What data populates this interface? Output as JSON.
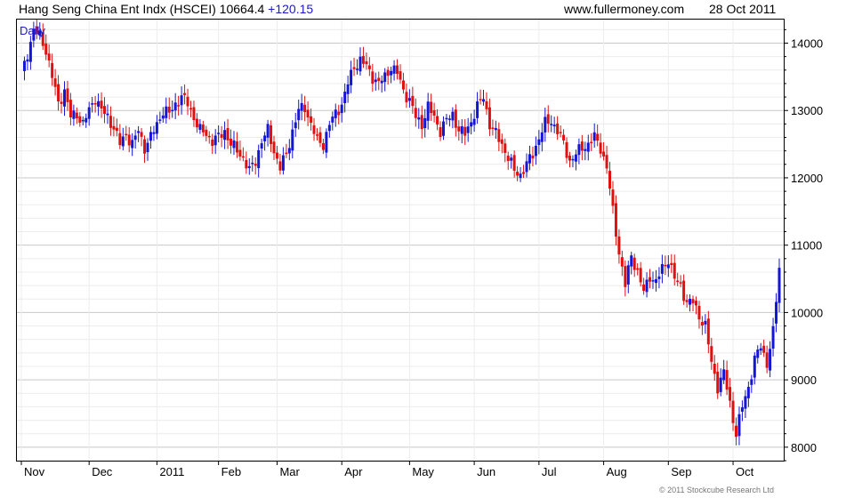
{
  "header": {
    "index_name": "Hang Seng China Ent Indx (HSCEI)",
    "last_value": "10664.4",
    "change": "+120.15",
    "website": "www.fullermoney.com",
    "date": "28 Oct 2011"
  },
  "copyright": "© 2011 Stockcube Research Ltd",
  "colors": {
    "up": "#1515d6",
    "down": "#e01010",
    "grid_major": "#c8c8c8",
    "grid_minor": "#ececec",
    "frame": "#000000"
  },
  "chart_data": {
    "type": "candlestick",
    "period_label": "Daily",
    "y_axis": {
      "side": "right",
      "ylim": [
        7800,
        14350
      ],
      "ticks": [
        8000,
        9000,
        10000,
        11000,
        12000,
        13000,
        14000
      ]
    },
    "x_axis": {
      "labels": [
        {
          "label": "Nov",
          "day": 0
        },
        {
          "label": "Dec",
          "day": 22
        },
        {
          "label": "2011",
          "day": 44
        },
        {
          "label": "Feb",
          "day": 64
        },
        {
          "label": "Mar",
          "day": 83
        },
        {
          "label": "Apr",
          "day": 104
        },
        {
          "label": "May",
          "day": 126
        },
        {
          "label": "Jun",
          "day": 147
        },
        {
          "label": "Jul",
          "day": 168
        },
        {
          "label": "Aug",
          "day": 189
        },
        {
          "label": "Sep",
          "day": 210
        },
        {
          "label": "Oct",
          "day": 231
        }
      ],
      "day_count": 247
    },
    "close_series": [
      [
        0,
        13500
      ],
      [
        2,
        13850
      ],
      [
        4,
        14200
      ],
      [
        6,
        14100
      ],
      [
        8,
        13900
      ],
      [
        10,
        13500
      ],
      [
        12,
        13100
      ],
      [
        14,
        13300
      ],
      [
        16,
        12900
      ],
      [
        18,
        12950
      ],
      [
        20,
        12800
      ],
      [
        22,
        13000
      ],
      [
        24,
        13200
      ],
      [
        26,
        13000
      ],
      [
        28,
        12900
      ],
      [
        30,
        12750
      ],
      [
        32,
        12500
      ],
      [
        34,
        12650
      ],
      [
        36,
        12500
      ],
      [
        38,
        12700
      ],
      [
        40,
        12450
      ],
      [
        42,
        12600
      ],
      [
        44,
        12800
      ],
      [
        46,
        13000
      ],
      [
        48,
        12950
      ],
      [
        50,
        13100
      ],
      [
        52,
        13200
      ],
      [
        54,
        13100
      ],
      [
        56,
        12900
      ],
      [
        58,
        12700
      ],
      [
        60,
        12650
      ],
      [
        62,
        12550
      ],
      [
        64,
        12600
      ],
      [
        66,
        12700
      ],
      [
        68,
        12500
      ],
      [
        70,
        12400
      ],
      [
        72,
        12300
      ],
      [
        74,
        12100
      ],
      [
        76,
        12250
      ],
      [
        78,
        12550
      ],
      [
        80,
        12700
      ],
      [
        82,
        12400
      ],
      [
        84,
        12150
      ],
      [
        86,
        12350
      ],
      [
        88,
        12700
      ],
      [
        90,
        13000
      ],
      [
        92,
        13050
      ],
      [
        94,
        12800
      ],
      [
        96,
        12550
      ],
      [
        98,
        12500
      ],
      [
        100,
        12800
      ],
      [
        102,
        12950
      ],
      [
        104,
        13100
      ],
      [
        106,
        13400
      ],
      [
        108,
        13650
      ],
      [
        110,
        13750
      ],
      [
        112,
        13650
      ],
      [
        114,
        13500
      ],
      [
        116,
        13400
      ],
      [
        118,
        13500
      ],
      [
        120,
        13650
      ],
      [
        122,
        13550
      ],
      [
        124,
        13300
      ],
      [
        126,
        13150
      ],
      [
        128,
        12900
      ],
      [
        130,
        12800
      ],
      [
        132,
        13050
      ],
      [
        134,
        12900
      ],
      [
        136,
        12700
      ],
      [
        138,
        12850
      ],
      [
        140,
        12950
      ],
      [
        142,
        12700
      ],
      [
        144,
        12650
      ],
      [
        146,
        12850
      ],
      [
        148,
        13050
      ],
      [
        150,
        13200
      ],
      [
        152,
        12800
      ],
      [
        154,
        12650
      ],
      [
        156,
        12500
      ],
      [
        158,
        12300
      ],
      [
        160,
        12100
      ],
      [
        162,
        12050
      ],
      [
        164,
        12200
      ],
      [
        166,
        12350
      ],
      [
        168,
        12600
      ],
      [
        170,
        12800
      ],
      [
        172,
        12850
      ],
      [
        174,
        12700
      ],
      [
        176,
        12500
      ],
      [
        178,
        12250
      ],
      [
        180,
        12350
      ],
      [
        182,
        12450
      ],
      [
        184,
        12500
      ],
      [
        186,
        12600
      ],
      [
        188,
        12450
      ],
      [
        190,
        12150
      ],
      [
        192,
        11500
      ],
      [
        194,
        10900
      ],
      [
        196,
        10400
      ],
      [
        198,
        10850
      ],
      [
        200,
        10600
      ],
      [
        202,
        10300
      ],
      [
        204,
        10550
      ],
      [
        206,
        10450
      ],
      [
        208,
        10650
      ],
      [
        210,
        10800
      ],
      [
        212,
        10500
      ],
      [
        214,
        10400
      ],
      [
        216,
        10150
      ],
      [
        218,
        10150
      ],
      [
        220,
        9950
      ],
      [
        222,
        9800
      ],
      [
        224,
        9250
      ],
      [
        226,
        8900
      ],
      [
        228,
        9100
      ],
      [
        230,
        8650
      ],
      [
        232,
        8200
      ],
      [
        234,
        8600
      ],
      [
        236,
        8900
      ],
      [
        238,
        9300
      ],
      [
        240,
        9500
      ],
      [
        242,
        9250
      ],
      [
        244,
        9700
      ],
      [
        246,
        10664.4
      ]
    ]
  }
}
